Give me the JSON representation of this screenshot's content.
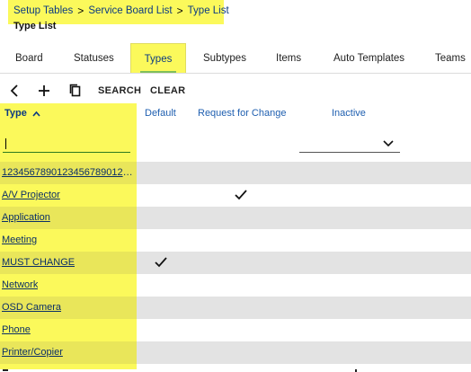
{
  "breadcrumb": {
    "items": [
      "Setup Tables",
      "Service Board List",
      "Type List"
    ],
    "separator": ">"
  },
  "page_title": "Type List",
  "tabs": [
    {
      "label": "Board",
      "active": false
    },
    {
      "label": "Statuses",
      "active": false
    },
    {
      "label": "Types",
      "active": true
    },
    {
      "label": "Subtypes",
      "active": false
    },
    {
      "label": "Items",
      "active": false
    },
    {
      "label": "Auto Templates",
      "active": false
    },
    {
      "label": "Teams",
      "active": false
    }
  ],
  "toolbar": {
    "back_icon": "chevron-left-icon",
    "add_icon": "plus-icon",
    "copy_icon": "copy-icon",
    "search_label": "SEARCH",
    "clear_label": "CLEAR"
  },
  "grid": {
    "columns": {
      "type": "Type",
      "sort_icon": "caret-up-icon",
      "default": "Default",
      "request_for_change": "Request for Change",
      "inactive": "Inactive"
    },
    "filter": {
      "type_value": "",
      "inactive_value": ""
    },
    "rows": [
      {
        "name": "12345678901234567890123456789012...",
        "default": false,
        "rfc": false
      },
      {
        "name": "A/V Projector",
        "default": false,
        "rfc": true
      },
      {
        "name": "Application",
        "default": false,
        "rfc": false
      },
      {
        "name": "Meeting",
        "default": false,
        "rfc": false
      },
      {
        "name": "MUST CHANGE",
        "default": true,
        "rfc": false
      },
      {
        "name": "Network",
        "default": false,
        "rfc": false
      },
      {
        "name": "OSD Camera",
        "default": false,
        "rfc": false
      },
      {
        "name": "Phone",
        "default": false,
        "rfc": false
      },
      {
        "name": "Printer/Copier",
        "default": false,
        "rfc": false
      }
    ]
  },
  "colors": {
    "highlight": "#fbf95b",
    "link": "#0b3a82",
    "header_link": "#1f5fb0",
    "row_shade": "#e3e3e3",
    "active_tab_underline": "#7fbf5a"
  }
}
